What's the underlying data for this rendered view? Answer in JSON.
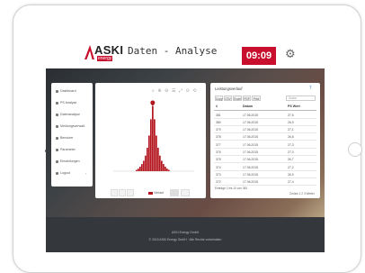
{
  "header": {
    "logo_text": "ASKI",
    "logo_sub": "energy",
    "app_title": "Daten - Analyse",
    "clock": "09:09",
    "brand_color": "#c8102e"
  },
  "sidebar": {
    "items": [
      {
        "label": "Dashboard",
        "icon": "dashboard-icon"
      },
      {
        "label": "PS Analyse",
        "icon": "chart-icon"
      },
      {
        "label": "Datenanalyse",
        "icon": "analysis-icon"
      },
      {
        "label": "Meldungsverwalt.",
        "icon": "message-icon"
      },
      {
        "label": "Benutzer",
        "icon": "user-icon"
      },
      {
        "label": "Parameter",
        "icon": "wrench-icon"
      },
      {
        "label": "Einstellungen",
        "icon": "gear-icon"
      },
      {
        "label": "Logout",
        "icon": "logout-icon"
      }
    ]
  },
  "chart_toolbar": {
    "icons": "⌕ ⊕ ⊖ ☰ ⤢ ⊙ ⟲"
  },
  "chart_data": {
    "type": "bar",
    "title": "",
    "xlabel": "",
    "ylabel": "",
    "values": [
      2,
      4,
      7,
      11,
      16,
      24,
      36,
      55,
      80,
      100,
      80,
      55,
      36,
      24,
      16,
      11,
      7,
      4,
      2
    ],
    "ylim": [
      0,
      100
    ],
    "marker_index": 9,
    "series_color": "#b3161f",
    "legend_label": "Verlauf"
  },
  "table": {
    "title": "Leistungsverlauf",
    "buttons": [
      "Copy",
      "CSV",
      "Excel",
      "PDF",
      "Print"
    ],
    "search_placeholder": "Suche",
    "headers": [
      "#",
      "Datum",
      "PS Wert"
    ],
    "rows": [
      {
        "id": "381",
        "datum": "17.06.2015",
        "wert": "27,6"
      },
      {
        "id": "380",
        "datum": "17.06.2015",
        "wert": "26,9"
      },
      {
        "id": "379",
        "datum": "17.06.2015",
        "wert": "27,1"
      },
      {
        "id": "378",
        "datum": "17.06.2015",
        "wert": "26,8"
      },
      {
        "id": "377",
        "datum": "17.06.2015",
        "wert": "27,3"
      },
      {
        "id": "376",
        "datum": "17.06.2015",
        "wert": "27,0"
      },
      {
        "id": "375",
        "datum": "17.06.2015",
        "wert": "26,7"
      },
      {
        "id": "374",
        "datum": "17.06.2015",
        "wert": "27,2"
      },
      {
        "id": "373",
        "datum": "17.06.2015",
        "wert": "26,9"
      },
      {
        "id": "372",
        "datum": "17.06.2015",
        "wert": "27,4"
      }
    ],
    "footer_info": "Einträge 1 bis 10 von 381",
    "pagination": "Zurück 1 2 3 Weiter"
  },
  "footer": {
    "line1": "ASKI Energy GmbH",
    "line2": "© 2015 ASKI Energy GmbH · Alle Rechte vorbehalten"
  }
}
